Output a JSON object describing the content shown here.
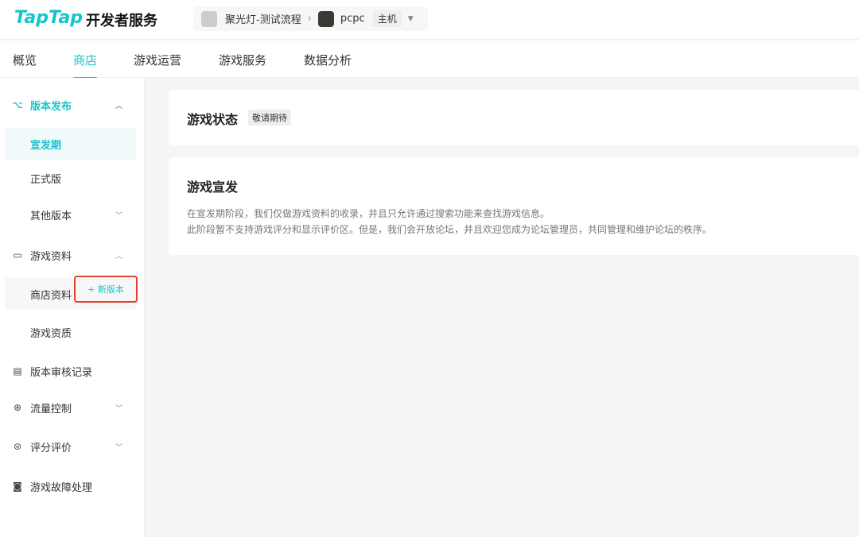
{
  "header": {
    "logo": "TapTap",
    "logo_sub": "开发者服务",
    "project": "聚光灯-测试流程",
    "game": "pcpc",
    "platform": "主机"
  },
  "nav": {
    "tabs": [
      "概览",
      "商店",
      "游戏运营",
      "游戏服务",
      "数据分析"
    ],
    "active": "商店"
  },
  "sidebar": {
    "release": "版本发布",
    "preheat": "宣发期",
    "official": "正式版",
    "other": "其他版本",
    "info": "游戏资料",
    "store": "商店资料",
    "new_version": "+ 新版本",
    "qualification": "游戏资质",
    "review": "版本审核记录",
    "traffic": "流量控制",
    "rating": "评分评价",
    "fault": "游戏故障处理"
  },
  "main": {
    "status_title": "游戏状态",
    "status_badge": "敬请期待",
    "promo_title": "游戏宣发",
    "promo_line1": "在宣发期阶段，我们仅做游戏资料的收录，并且只允许通过搜索功能来查找游戏信息。",
    "promo_line2": "此阶段暂不支持游戏评分和显示评价区。但是，我们会开放论坛，并且欢迎您成为论坛管理员，共同管理和维护论坛的秩序。"
  }
}
